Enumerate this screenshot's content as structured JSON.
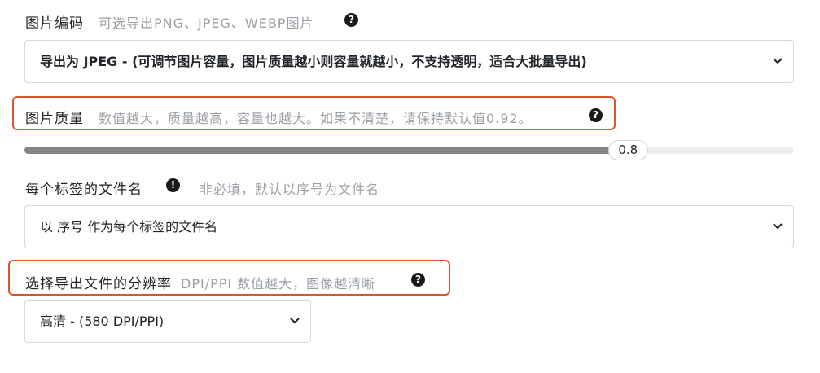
{
  "encoding": {
    "label": "图片编码",
    "hint": "可选导出PNG、JPEG、WEBP图片",
    "selected": "导出为 JPEG - (可调节图片容量，图片质量越小则容量就越小，不支持透明，适合大批量导出)"
  },
  "quality": {
    "label": "图片质量",
    "hint": "数值越大，质量越高，容量也越大。如果不清楚，请保持默认值0.92。",
    "value": "0.8",
    "level": 0.8
  },
  "filename": {
    "label": "每个标签的文件名",
    "hint": "非必填，默认以序号为文件名",
    "selected": "以 序号 作为每个标签的文件名"
  },
  "resolution": {
    "label": "选择导出文件的分辨率",
    "hint": "DPI/PPI 数值越大，图像越清晰",
    "selected": "高清 - (580 DPI/PPI)"
  },
  "icons": {
    "help": "question-circle-icon",
    "info": "exclamation-circle-icon",
    "dropdown": "chevron-down-icon"
  },
  "colors": {
    "highlight": "#d9582b",
    "slider_fill": "#858585",
    "slider_track": "#edf0f3"
  }
}
